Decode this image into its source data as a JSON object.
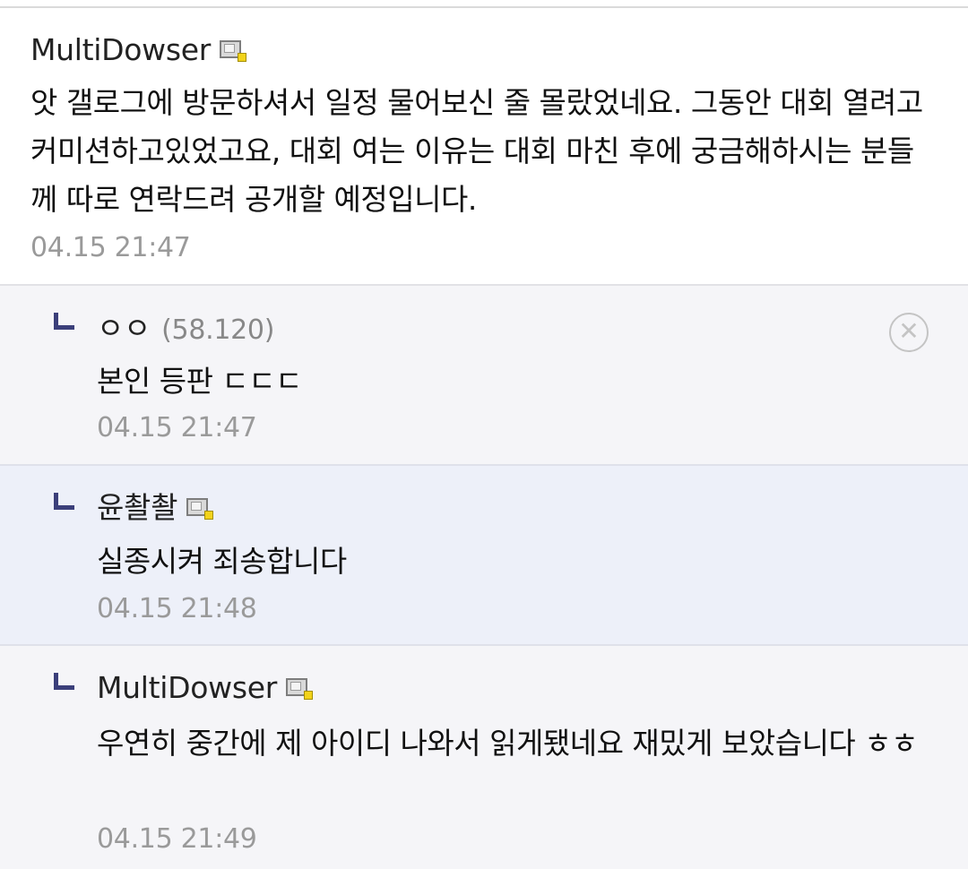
{
  "main_comment": {
    "nickname": "MultiDowser",
    "icon": "gallery-user-icon",
    "body": "앗 갤로그에 방문하셔서 일정 물어보신 줄 몰랐었네요. 그동안 대회 열려고 커미션하고있었고요, 대회 여는 이유는 대회 마친 후에 궁금해하시는 분들께 따로 연락드려 공개할 예정입니다.",
    "date": "04.15 21:47"
  },
  "replies": [
    {
      "nickname": "ㅇㅇ",
      "ip": "(58.120)",
      "body": "본인 등판 ㄷㄷㄷ",
      "date": "04.15 21:47",
      "delete_icon": "close-circle-icon"
    },
    {
      "nickname": "윤촬촬",
      "icon": "gallery-user-icon",
      "body": "실종시켜 죄송합니다",
      "date": "04.15 21:48"
    },
    {
      "nickname": "MultiDowser",
      "icon": "gallery-user-icon",
      "body": "우연히 중간에 제 아이디 나와서 읽게됐네요 재밌게 보았습니다 ㅎㅎ",
      "date": "04.15 21:49"
    }
  ],
  "colors": {
    "reply_mark": "#3b3f7a",
    "reply_bg": "#f5f5f8",
    "highlight_bg": "#edf0f9",
    "date": "#9a9a9a"
  }
}
